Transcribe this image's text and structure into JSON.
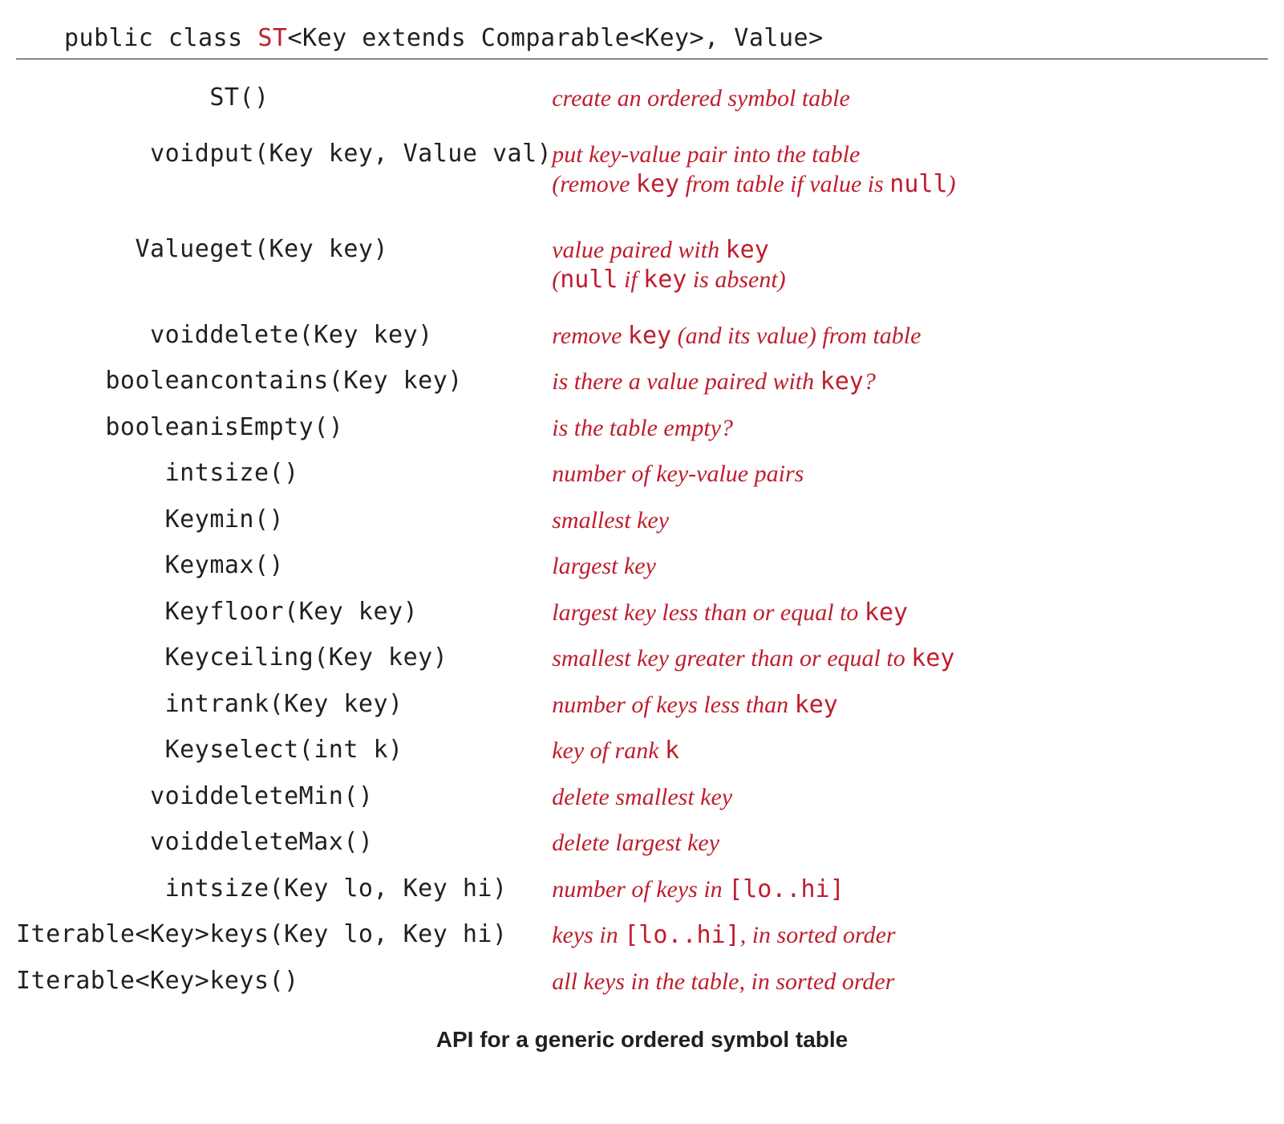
{
  "header": {
    "prefix": "public class ",
    "classname": "ST",
    "suffix": "<Key extends Comparable<Key>, Value>"
  },
  "rows": [
    {
      "ret": "",
      "sig": "ST()",
      "desc_parts": [
        {
          "t": "text",
          "v": "create an ordered symbol table"
        }
      ]
    },
    {
      "gap": true,
      "ret": "void",
      "sig": "put(Key key, Value val)",
      "desc_parts": [
        {
          "t": "text",
          "v": "put key-value pair into the table"
        },
        {
          "t": "br"
        },
        {
          "t": "text",
          "v": "(remove "
        },
        {
          "t": "code",
          "v": "key"
        },
        {
          "t": "text",
          "v": " from table if value is "
        },
        {
          "t": "code",
          "v": "null"
        },
        {
          "t": "text",
          "v": ")"
        }
      ]
    },
    {
      "gap": true,
      "ret": "Value",
      "sig": "get(Key key)",
      "desc_parts": [
        {
          "t": "text",
          "v": "value paired with "
        },
        {
          "t": "code",
          "v": "key"
        },
        {
          "t": "br"
        },
        {
          "t": "text",
          "v": "("
        },
        {
          "t": "code",
          "v": "null"
        },
        {
          "t": "text",
          "v": " if "
        },
        {
          "t": "code",
          "v": "key"
        },
        {
          "t": "text",
          "v": " is absent)"
        }
      ]
    },
    {
      "ret": "void",
      "sig": "delete(Key key)",
      "desc_parts": [
        {
          "t": "text",
          "v": "remove "
        },
        {
          "t": "code",
          "v": "key"
        },
        {
          "t": "text",
          "v": " (and its value) from table"
        }
      ]
    },
    {
      "ret": "boolean",
      "sig": "contains(Key key)",
      "desc_parts": [
        {
          "t": "text",
          "v": "is there a value paired with "
        },
        {
          "t": "code",
          "v": "key"
        },
        {
          "t": "text",
          "v": "?"
        }
      ]
    },
    {
      "ret": "boolean",
      "sig": "isEmpty()",
      "desc_parts": [
        {
          "t": "text",
          "v": "is the table empty?"
        }
      ]
    },
    {
      "ret": "int",
      "sig": "size()",
      "desc_parts": [
        {
          "t": "text",
          "v": "number of key-value pairs"
        }
      ]
    },
    {
      "ret": "Key",
      "sig": "min()",
      "desc_parts": [
        {
          "t": "text",
          "v": "smallest key"
        }
      ]
    },
    {
      "ret": "Key",
      "sig": "max()",
      "desc_parts": [
        {
          "t": "text",
          "v": "largest key"
        }
      ]
    },
    {
      "ret": "Key",
      "sig": "floor(Key key)",
      "desc_parts": [
        {
          "t": "text",
          "v": "largest key less than or equal to "
        },
        {
          "t": "code",
          "v": "key"
        }
      ]
    },
    {
      "ret": "Key",
      "sig": "ceiling(Key key)",
      "desc_parts": [
        {
          "t": "text",
          "v": "smallest key greater than or equal to "
        },
        {
          "t": "code",
          "v": "key"
        }
      ]
    },
    {
      "ret": "int",
      "sig": "rank(Key key)",
      "desc_parts": [
        {
          "t": "text",
          "v": "number of keys less than "
        },
        {
          "t": "code",
          "v": "key"
        }
      ]
    },
    {
      "ret": "Key",
      "sig": "select(int k)",
      "desc_parts": [
        {
          "t": "text",
          "v": "key of rank "
        },
        {
          "t": "code",
          "v": "k"
        }
      ]
    },
    {
      "ret": "void",
      "sig": "deleteMin()",
      "desc_parts": [
        {
          "t": "text",
          "v": "delete smallest key"
        }
      ]
    },
    {
      "ret": "void",
      "sig": "deleteMax()",
      "desc_parts": [
        {
          "t": "text",
          "v": "delete largest key"
        }
      ]
    },
    {
      "ret": "int",
      "sig": "size(Key lo, Key hi)",
      "desc_parts": [
        {
          "t": "text",
          "v": "number of keys in "
        },
        {
          "t": "code",
          "v": "[lo..hi]"
        }
      ]
    },
    {
      "ret": "Iterable<Key>",
      "sig": "keys(Key lo, Key hi)",
      "desc_parts": [
        {
          "t": "text",
          "v": "keys in "
        },
        {
          "t": "code",
          "v": "[lo..hi]"
        },
        {
          "t": "text",
          "v": ", in sorted order"
        }
      ]
    },
    {
      "ret": "Iterable<Key>",
      "sig": "keys()",
      "desc_parts": [
        {
          "t": "text",
          "v": "all keys in the table, in sorted order"
        }
      ]
    }
  ],
  "caption": "API for a generic ordered symbol table"
}
